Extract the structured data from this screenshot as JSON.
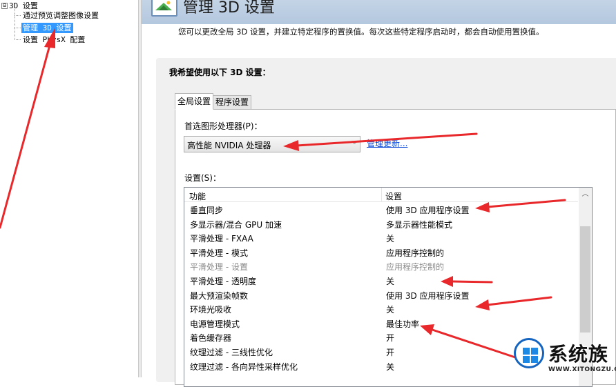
{
  "tree": {
    "expander": "⊟",
    "root_label": "3D 设置",
    "items": [
      {
        "label": "通过预览调整图像设置",
        "selected": false
      },
      {
        "label": "管理 3D 设置",
        "selected": true
      },
      {
        "label": "设置 PhysX 配置",
        "selected": false
      }
    ]
  },
  "header": {
    "title": "管理 3D 设置",
    "description": "您可以更改全局 3D 设置，并建立特定程序的置换值。每次这些特定程序启动时，都会自动使用置换值。"
  },
  "main": {
    "heading": "我希望使用以下 3D 设置：",
    "tabs": [
      {
        "label": "全局设置",
        "active": true
      },
      {
        "label": "程序设置",
        "active": false
      }
    ],
    "gpu_label": "首选图形处理器(P)：",
    "gpu_value": "高性能 NVIDIA 处理器",
    "restore_link": "管理更新...",
    "settings_label": "设置(S)：",
    "grid": {
      "headers": [
        "功能",
        "设置"
      ],
      "rows": [
        {
          "feature": "垂直同步",
          "value": "使用 3D 应用程序设置",
          "disabled": false
        },
        {
          "feature": "多显示器/混合 GPU 加速",
          "value": "多显示器性能模式",
          "disabled": false
        },
        {
          "feature": "平滑处理 - FXAA",
          "value": "关",
          "disabled": false
        },
        {
          "feature": "平滑处理 - 模式",
          "value": "应用程序控制的",
          "disabled": false
        },
        {
          "feature": "平滑处理 - 设置",
          "value": "应用程序控制的",
          "disabled": true
        },
        {
          "feature": "平滑处理 - 透明度",
          "value": "关",
          "disabled": false
        },
        {
          "feature": "最大预渲染帧数",
          "value": "使用 3D 应用程序设置",
          "disabled": false
        },
        {
          "feature": "环境光吸收",
          "value": "关",
          "disabled": false
        },
        {
          "feature": "电源管理模式",
          "value": "最佳功率",
          "disabled": false
        },
        {
          "feature": "着色缓存器",
          "value": "开",
          "disabled": false
        },
        {
          "feature": "纹理过滤 - 三线性优化",
          "value": "开",
          "disabled": false
        },
        {
          "feature": "纹理过滤 - 各向异性采样优化",
          "value": "关",
          "disabled": false
        }
      ]
    }
  },
  "watermark": {
    "brand": "系统族",
    "url": "WWW.XITONGZU.COM"
  },
  "colors": {
    "selection": "#3399ff",
    "link": "#0645d6",
    "annotation_arrow": "#e8282b",
    "header_bg": "#b9cce2"
  },
  "icons": {
    "header": "nvidia-3d-settings-icon",
    "dropdown": "chevron-down-icon",
    "scroll_up": "scroll-up-arrow-icon"
  }
}
